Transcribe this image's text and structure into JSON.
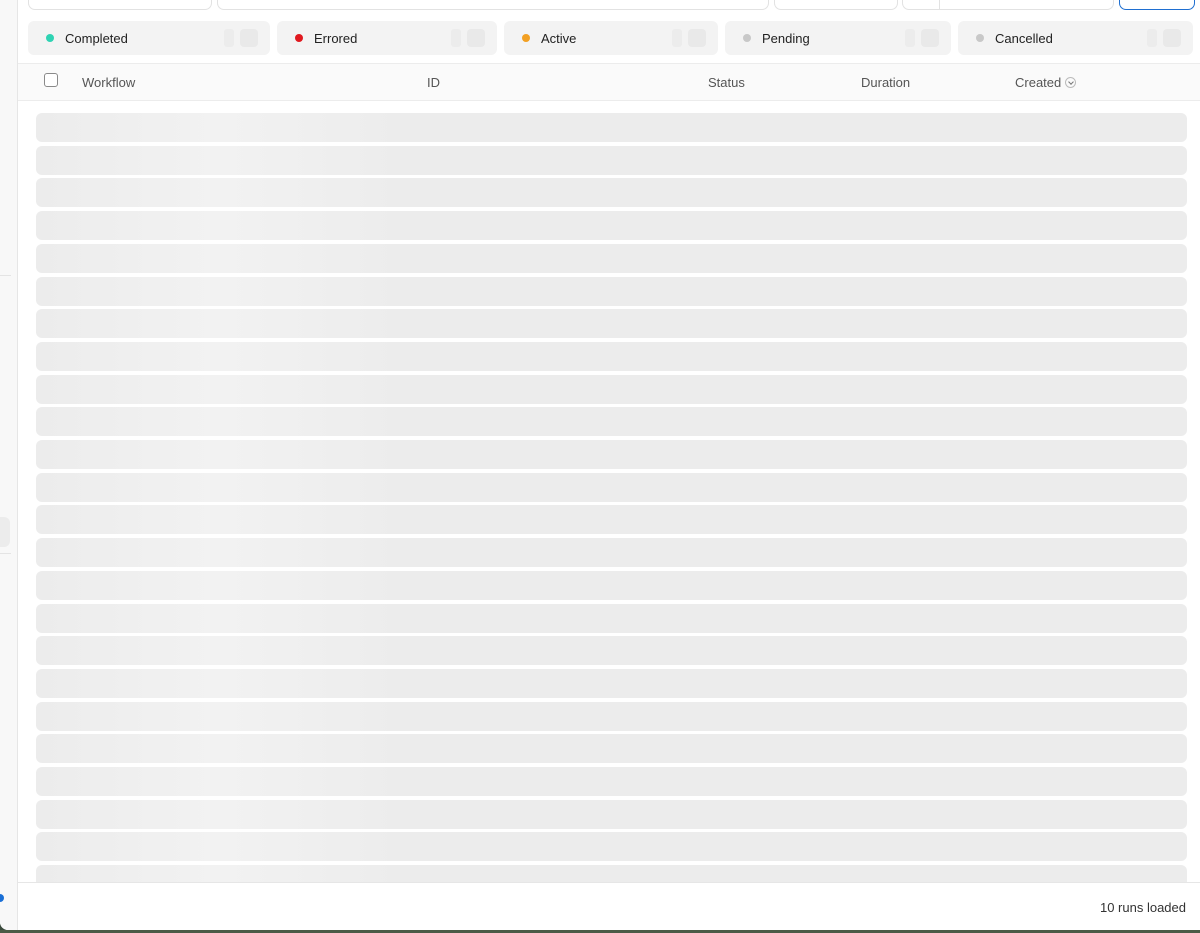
{
  "status_filters": [
    {
      "label": "Completed",
      "color": "#2fd3b3"
    },
    {
      "label": "Errored",
      "color": "#e0191f"
    },
    {
      "label": "Active",
      "color": "#f2a023"
    },
    {
      "label": "Pending",
      "color": "#c8c8c8"
    },
    {
      "label": "Cancelled",
      "color": "#c8c8c8"
    }
  ],
  "table": {
    "columns": [
      "Workflow",
      "ID",
      "Status",
      "Duration",
      "Created"
    ],
    "sort_icon": "chevron-down-icon",
    "loading_rows": 24
  },
  "footer": {
    "status": "10 runs loaded"
  }
}
